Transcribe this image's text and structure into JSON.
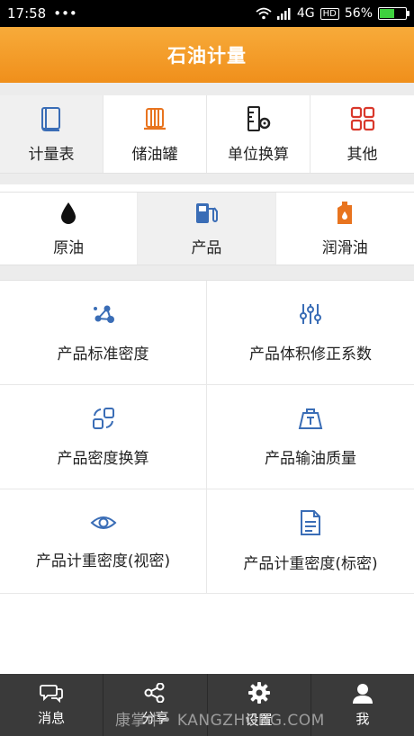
{
  "status_bar": {
    "time": "17:58",
    "dots": "•••",
    "network": "4G",
    "hd": "HD",
    "battery": "56%",
    "battery_level": 0.56
  },
  "header": {
    "title": "石油计量"
  },
  "categories": [
    {
      "label": "计量表",
      "icon": "book-icon",
      "active": true
    },
    {
      "label": "储油罐",
      "icon": "tank-icon",
      "active": false
    },
    {
      "label": "单位换算",
      "icon": "ruler-gear-icon",
      "active": false
    },
    {
      "label": "其他",
      "icon": "grid-icon",
      "active": false
    }
  ],
  "subcategories": [
    {
      "label": "原油",
      "icon": "oil-drop-icon",
      "active": false
    },
    {
      "label": "产品",
      "icon": "fuel-pump-icon",
      "active": true
    },
    {
      "label": "润滑油",
      "icon": "oil-can-icon",
      "active": false
    }
  ],
  "functions": [
    {
      "label": "产品标准密度",
      "icon": "molecule-icon"
    },
    {
      "label": "产品体积修正系数",
      "icon": "sliders-icon"
    },
    {
      "label": "产品密度换算",
      "icon": "convert-icon"
    },
    {
      "label": "产品输油质量",
      "icon": "weight-icon"
    },
    {
      "label": "产品计重密度(视密)",
      "icon": "eye-icon"
    },
    {
      "label": "产品计重密度(标密)",
      "icon": "document-icon"
    }
  ],
  "bottom_nav": [
    {
      "label": "消息",
      "icon": "chat-icon"
    },
    {
      "label": "分享",
      "icon": "share-icon"
    },
    {
      "label": "设置",
      "icon": "gear-icon"
    },
    {
      "label": "我",
      "icon": "user-icon"
    }
  ],
  "watermark": "康掌中• KANGZHONG.COM",
  "colors": {
    "accent": "#f39a25",
    "blue": "#3a6db6",
    "orange": "#e8741f",
    "nav_bg": "#3a3a3a"
  }
}
